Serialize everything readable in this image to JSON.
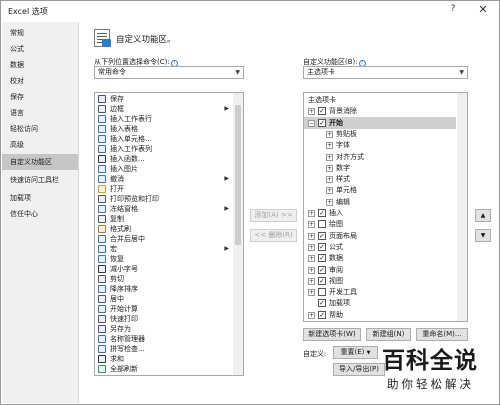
{
  "window": {
    "title": "Excel 选项",
    "help": "?",
    "close": "✕"
  },
  "nav": {
    "items": [
      "常规",
      "公式",
      "数据",
      "校对",
      "保存",
      "语言",
      "轻松访问",
      "高级",
      "自定义功能区",
      "快速访问工具栏",
      "加载项",
      "信任中心"
    ],
    "selected": "自定义功能区"
  },
  "header": {
    "title": "自定义功能区。"
  },
  "left": {
    "label": "从下列位置选择命令(C):",
    "combo_value": "常用命令",
    "commands": [
      {
        "label": "保存",
        "icon": "save-icon",
        "color": "#5b3f9e",
        "sub": false
      },
      {
        "label": "边框",
        "icon": "border-icon",
        "color": "#555555",
        "sub": true
      },
      {
        "label": "插入工作表行",
        "icon": "insert-row-icon",
        "color": "#3d6fa6",
        "sub": false
      },
      {
        "label": "插入表格",
        "icon": "table-icon",
        "color": "#3d6fa6",
        "sub": false
      },
      {
        "label": "插入单元格...",
        "icon": "insert-cell-icon",
        "color": "#3d6fa6",
        "sub": false
      },
      {
        "label": "插入工作表列",
        "icon": "insert-column-icon",
        "color": "#3d6fa6",
        "sub": false
      },
      {
        "label": "插入函数...",
        "icon": "function-icon",
        "color": "#333333",
        "sub": false
      },
      {
        "label": "插入图片",
        "icon": "picture-icon",
        "color": "#3d6fa6",
        "sub": false
      },
      {
        "label": "撤消",
        "icon": "undo-icon",
        "color": "#2b7cd3",
        "sub": true
      },
      {
        "label": "打开",
        "icon": "open-icon",
        "color": "#d9a400",
        "sub": false
      },
      {
        "label": "打印预览和打印",
        "icon": "print-preview-icon",
        "color": "#555555",
        "sub": false
      },
      {
        "label": "冻结窗格",
        "icon": "freeze-panes-icon",
        "color": "#3d6fa6",
        "sub": true
      },
      {
        "label": "复制",
        "icon": "copy-icon",
        "color": "#555555",
        "sub": false
      },
      {
        "label": "格式刷",
        "icon": "format-painter-icon",
        "color": "#c77c00",
        "sub": false
      },
      {
        "label": "合并后居中",
        "icon": "merge-center-icon",
        "color": "#3d6fa6",
        "sub": false
      },
      {
        "label": "宏",
        "icon": "macro-icon",
        "color": "#3d6fa6",
        "sub": true
      },
      {
        "label": "恢复",
        "icon": "redo-icon",
        "color": "#2b7cd3",
        "sub": false
      },
      {
        "label": "减小字号",
        "icon": "font-size-decrease-icon",
        "color": "#333333",
        "sub": false
      },
      {
        "label": "剪切",
        "icon": "cut-icon",
        "color": "#555555",
        "sub": false
      },
      {
        "label": "降序排序",
        "icon": "sort-descending-icon",
        "color": "#3d6fa6",
        "sub": false
      },
      {
        "label": "居中",
        "icon": "align-center-icon",
        "color": "#555555",
        "sub": false
      },
      {
        "label": "开始计算",
        "icon": "calculate-icon",
        "color": "#3d6fa6",
        "sub": false
      },
      {
        "label": "快速打印",
        "icon": "quick-print-icon",
        "color": "#555555",
        "sub": false
      },
      {
        "label": "另存为",
        "icon": "save-as-icon",
        "color": "#5b3f9e",
        "sub": false
      },
      {
        "label": "名称管理器",
        "icon": "name-manager-icon",
        "color": "#3d6fa6",
        "sub": false
      },
      {
        "label": "拼写检查...",
        "icon": "spelling-icon",
        "color": "#3d6fa6",
        "sub": false
      },
      {
        "label": "求和",
        "icon": "sum-icon",
        "color": "#333333",
        "sub": false
      },
      {
        "label": "全部刷新",
        "icon": "refresh-all-icon",
        "color": "#2e9b47",
        "sub": false
      }
    ]
  },
  "mid": {
    "add": "添加(A) >>",
    "remove": "<< 删除(R)"
  },
  "right": {
    "label": "自定义功能区(B):",
    "combo_value": "主选项卡",
    "tree": [
      {
        "label": "主选项卡",
        "level": 0,
        "exp": "",
        "check": null,
        "bold": false
      },
      {
        "label": "背景消除",
        "level": 1,
        "exp": "⊞",
        "check": true,
        "bold": false
      },
      {
        "label": "开始",
        "level": 1,
        "exp": "⊟",
        "check": true,
        "bold": true,
        "selected": true
      },
      {
        "label": "剪贴板",
        "level": 2,
        "exp": "⊞",
        "check": null,
        "bold": false
      },
      {
        "label": "字体",
        "level": 2,
        "exp": "⊞",
        "check": null,
        "bold": false
      },
      {
        "label": "对齐方式",
        "level": 2,
        "exp": "⊞",
        "check": null,
        "bold": false
      },
      {
        "label": "数字",
        "level": 2,
        "exp": "⊞",
        "check": null,
        "bold": false
      },
      {
        "label": "样式",
        "level": 2,
        "exp": "⊞",
        "check": null,
        "bold": false
      },
      {
        "label": "单元格",
        "level": 2,
        "exp": "⊞",
        "check": null,
        "bold": false
      },
      {
        "label": "编辑",
        "level": 2,
        "exp": "⊞",
        "check": null,
        "bold": false
      },
      {
        "label": "插入",
        "level": 1,
        "exp": "⊞",
        "check": true,
        "bold": false
      },
      {
        "label": "绘图",
        "level": 1,
        "exp": "⊞",
        "check": false,
        "bold": false
      },
      {
        "label": "页面布局",
        "level": 1,
        "exp": "⊞",
        "check": true,
        "bold": false
      },
      {
        "label": "公式",
        "level": 1,
        "exp": "⊞",
        "check": true,
        "bold": false
      },
      {
        "label": "数据",
        "level": 1,
        "exp": "⊞",
        "check": true,
        "bold": false
      },
      {
        "label": "审阅",
        "level": 1,
        "exp": "⊞",
        "check": true,
        "bold": false
      },
      {
        "label": "视图",
        "level": 1,
        "exp": "⊞",
        "check": true,
        "bold": false
      },
      {
        "label": "开发工具",
        "level": 1,
        "exp": "⊞",
        "check": false,
        "bold": false
      },
      {
        "label": "加载项",
        "level": 1,
        "exp": "",
        "check": true,
        "bold": false
      },
      {
        "label": "帮助",
        "level": 1,
        "exp": "⊞",
        "check": true,
        "bold": false
      }
    ],
    "buttons": {
      "new_tab": "新建选项卡(W)",
      "new_group": "新建组(N)",
      "rename": "重命名(M)..."
    },
    "custom_label": "自定义:",
    "reset_label": "重置(E)",
    "import_export": "导入/导出(P)"
  },
  "move": {
    "up": "▲",
    "down": "▼"
  },
  "watermark": {
    "line1": "百科全说",
    "line2": "助你轻松解决"
  }
}
